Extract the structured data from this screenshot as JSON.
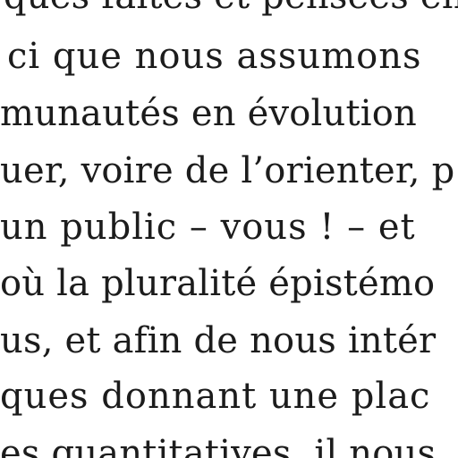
{
  "document": {
    "lines": [
      "ques faites et pensées en",
      "ci que nous assumons",
      "munautés en évolution",
      "uer, voire de l’orienter, p",
      "un public – vous ! – et",
      "où la pluralité épistémo",
      "us, et afin de nous intér",
      "ques donnant une plac",
      "es quantitatives, il nous"
    ]
  }
}
